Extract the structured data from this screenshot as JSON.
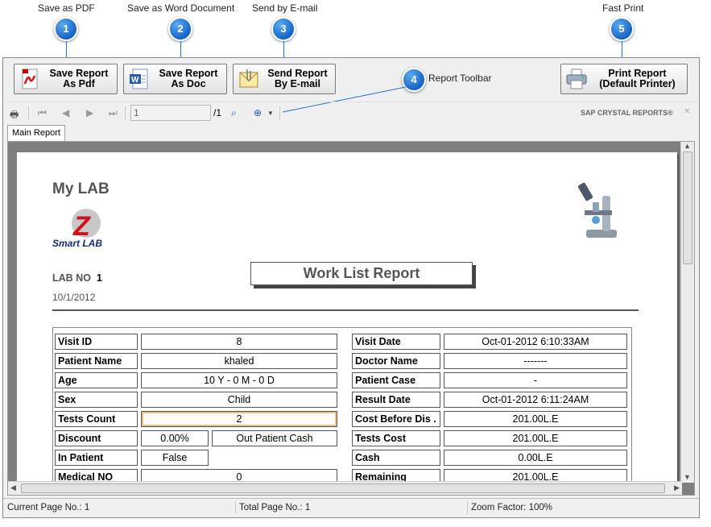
{
  "callouts": [
    {
      "number": "1",
      "label": "Save as PDF"
    },
    {
      "number": "2",
      "label": "Save as Word Document"
    },
    {
      "number": "3",
      "label": "Send by E-mail"
    },
    {
      "number": "4",
      "label": "Report Toolbar"
    },
    {
      "number": "5",
      "label": "Fast Print"
    }
  ],
  "toolbar": {
    "pdf_button": [
      "Save Report",
      "As Pdf"
    ],
    "doc_button": [
      "Save Report",
      "As Doc"
    ],
    "email_button": [
      "Send Report",
      "By E-mail"
    ],
    "print_button": [
      "Print Report",
      "(Default Printer)"
    ]
  },
  "crystal_toolbar": {
    "page_value": "1",
    "page_total": "/1",
    "brand": "SAP CRYSTAL REPORTS®"
  },
  "tabs": [
    "Main Report"
  ],
  "report": {
    "lab_name": "My LAB",
    "logo_text": "Smart LAB",
    "logo_letter": "Z",
    "lab_no_label": "LAB NO",
    "lab_no_value": "1",
    "date": "10/1/2012",
    "title": "Work List Report",
    "left_rows": [
      {
        "label": "Visit ID",
        "value": "8"
      },
      {
        "label": "Patient Name",
        "value": "khaled"
      },
      {
        "label": "Age",
        "value": "10 Y - 0 M - 0 D"
      },
      {
        "label": "Sex",
        "value": "Child"
      },
      {
        "label": "Tests Count",
        "value": "2"
      },
      {
        "label": "Discount",
        "value": "0.00%",
        "extra": "Out Patient Cash"
      },
      {
        "label": "In Patient",
        "value": "False"
      },
      {
        "label": "Medical NO",
        "value": "0"
      }
    ],
    "right_rows": [
      {
        "label": "Visit Date",
        "value": "Oct-01-2012   6:10:33AM"
      },
      {
        "label": "Doctor Name",
        "value": "-------"
      },
      {
        "label": "Patient Case",
        "value": "-"
      },
      {
        "label": "Result Date",
        "value": "Oct-01-2012   6:11:24AM"
      },
      {
        "label": "Cost Before Dis .",
        "value": "201.00L.E"
      },
      {
        "label": "Tests Cost",
        "value": "201.00L.E"
      },
      {
        "label": "Cash",
        "value": "0.00L.E"
      },
      {
        "label": "Remaining",
        "value": "201.00L.E"
      }
    ]
  },
  "status": {
    "current_page": "Current Page No.: 1",
    "total_page": "Total Page No.: 1",
    "zoom": "Zoom Factor: 100%"
  },
  "colors": {
    "accent": "#1565c8",
    "title_text": "#555555"
  }
}
